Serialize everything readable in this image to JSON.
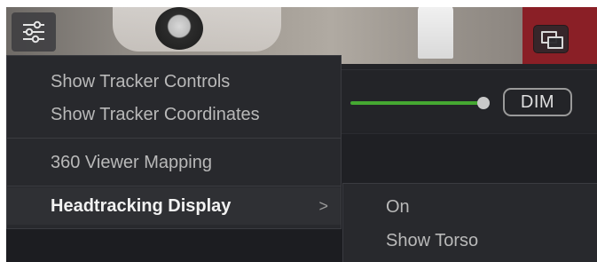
{
  "viewer": {
    "options_icon": "sliders-icon",
    "pip_icon": "picture-in-picture-icon"
  },
  "controls": {
    "slider_color": "#45a832",
    "dim_label": "DIM"
  },
  "menu": {
    "items": [
      {
        "label": "Show Tracker Controls"
      },
      {
        "label": "Show Tracker Coordinates"
      },
      {
        "label": "360 Viewer Mapping"
      },
      {
        "label": "Headtracking Display",
        "highlighted": true,
        "has_submenu": true
      }
    ],
    "submenu_arrow": ">"
  },
  "submenu": {
    "items": [
      {
        "label": "On"
      },
      {
        "label": "Show Torso"
      }
    ]
  }
}
